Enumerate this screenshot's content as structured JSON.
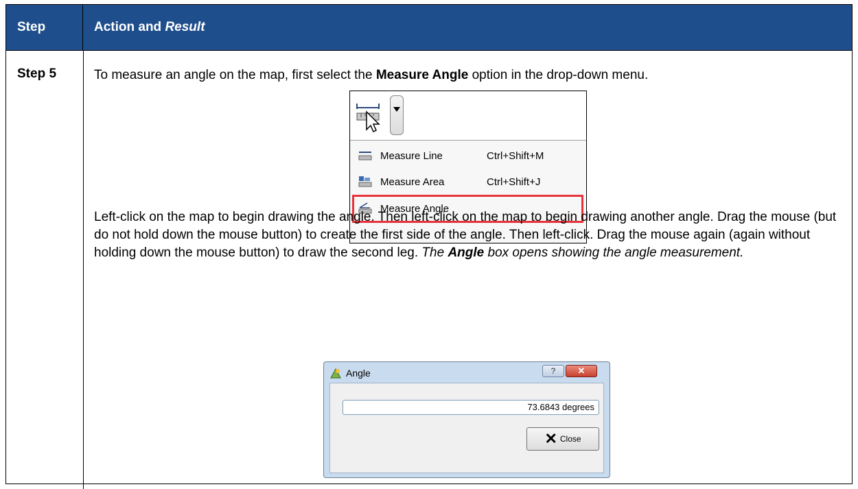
{
  "header": {
    "step_label": "Step",
    "action_label": "Action and ",
    "result_label": "Result"
  },
  "row": {
    "step": "Step 5",
    "para1": {
      "pre": "To measure an angle on the map, first select the ",
      "bold": "Measure Angle",
      "post": " option in the drop-down menu."
    },
    "para2": {
      "text": "Left-click on the map to begin drawing the angle. Then left-click on the map to begin drawing another angle. Drag the mouse (but do not hold down the mouse button) to create the first side of the angle. Then left-click. Drag the mouse again (again without holding down the mouse button) to draw the second leg. ",
      "result_pre": "The ",
      "result_bold": "Angle",
      "result_post": " box opens showing the angle measurement."
    }
  },
  "menu": {
    "items": [
      {
        "label": "Measure Line",
        "shortcut": "Ctrl+Shift+M"
      },
      {
        "label": "Measure Area",
        "shortcut": "Ctrl+Shift+J"
      },
      {
        "label": "Measure Angle",
        "shortcut": ""
      }
    ],
    "highlight_color": "#e8333b"
  },
  "dialog": {
    "title": "Angle",
    "help_glyph": "?",
    "close_glyph": "✕",
    "value": "73.6843 degrees",
    "button_label": "Close"
  },
  "colors": {
    "header_bg": "#1f4e8c",
    "header_text": "#ffffff"
  }
}
